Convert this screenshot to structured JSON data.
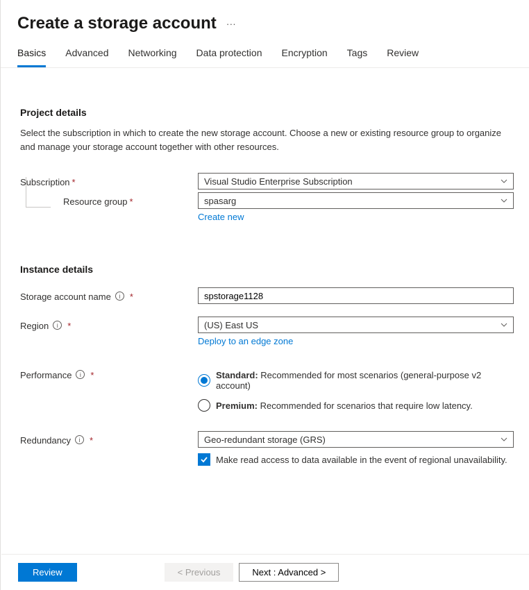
{
  "header": {
    "title": "Create a storage account",
    "ellipsis": "···"
  },
  "tabs": [
    "Basics",
    "Advanced",
    "Networking",
    "Data protection",
    "Encryption",
    "Tags",
    "Review"
  ],
  "activeTab": "Basics",
  "project": {
    "title": "Project details",
    "desc": "Select the subscription in which to create the new storage account. Choose a new or existing resource group to organize and manage your storage account together with other resources.",
    "subscriptionLabel": "Subscription",
    "subscriptionValue": "Visual Studio Enterprise Subscription",
    "resourceGroupLabel": "Resource group",
    "resourceGroupValue": "spasarg",
    "createNew": "Create new"
  },
  "instance": {
    "title": "Instance details",
    "nameLabel": "Storage account name",
    "nameValue": "spstorage1128",
    "regionLabel": "Region",
    "regionValue": "(US) East US",
    "edgeLink": "Deploy to an edge zone",
    "performanceLabel": "Performance",
    "performance": {
      "standardBold": "Standard:",
      "standardRest": " Recommended for most scenarios (general-purpose v2 account)",
      "premiumBold": "Premium:",
      "premiumRest": " Recommended for scenarios that require low latency."
    },
    "redundancyLabel": "Redundancy",
    "redundancyValue": "Geo-redundant storage (GRS)",
    "readAccessLabel": "Make read access to data available in the event of regional unavailability."
  },
  "footer": {
    "review": "Review",
    "previous": "< Previous",
    "next": "Next : Advanced >"
  }
}
